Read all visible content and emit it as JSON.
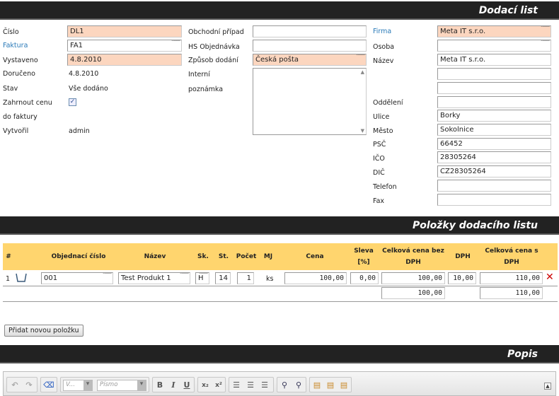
{
  "sections": {
    "delivery_note": "Dodací list",
    "items": "Položky dodacího listu",
    "description": "Popis"
  },
  "left": {
    "number_label": "Číslo",
    "number_value": "DL1",
    "invoice_label": "Faktura",
    "invoice_value": "FA1",
    "issued_label": "Vystaveno",
    "issued_value": "4.8.2010",
    "delivered_label": "Doručeno",
    "delivered_value": "4.8.2010",
    "state_label": "Stav",
    "state_value": "Vše dodáno",
    "include_price_label_1": "Zahrnout cenu",
    "include_price_label_2": "do faktury",
    "include_price_checked": true,
    "created_label": "Vytvořil",
    "created_value": "admin"
  },
  "middle": {
    "business_case_label": "Obchodní případ",
    "business_case_value": "",
    "hs_order_label": "HS Objednávka",
    "hs_order_value": "",
    "delivery_method_label": "Způsob dodání",
    "delivery_method_value": "Česká pošta",
    "internal_label": "Interní",
    "note_label": "poznámka",
    "note_value": ""
  },
  "right": {
    "company_label": "Firma",
    "company_value": "Meta IT s.r.o.",
    "person_label": "Osoba",
    "person_value": "",
    "name_label": "Název",
    "name_value": "Meta IT s.r.o.",
    "name_line2": "",
    "name_line3": "",
    "department_label": "Oddělení",
    "department_value": "",
    "street_label": "Ulice",
    "street_value": "Borky",
    "city_label": "Město",
    "city_value": "Sokolnice",
    "zip_label": "PSČ",
    "zip_value": "66452",
    "ico_label": "IČO",
    "ico_value": "28305264",
    "dic_label": "DIČ",
    "dic_value": "CZ28305264",
    "phone_label": "Telefon",
    "phone_value": "",
    "fax_label": "Fax",
    "fax_value": ""
  },
  "table": {
    "headers": {
      "index": "#",
      "order_no": "Objednací číslo",
      "name": "Název",
      "warehouse": "Sk.",
      "state": "St.",
      "count": "Počet",
      "unit": "MJ",
      "price": "Cena",
      "discount_1": "Sleva",
      "discount_2": "[%]",
      "total_novat_1": "Celková cena bez",
      "total_novat_2": "DPH",
      "vat": "DPH",
      "total_vat_1": "Celková cena s",
      "total_vat_2": "DPH"
    },
    "rows": [
      {
        "index": "1",
        "order_no": "001",
        "name": "Test Produkt 1",
        "warehouse": "H",
        "state": "14",
        "count": "1",
        "unit": "ks",
        "price": "100,00",
        "discount": "0,00",
        "total_novat": "100,00",
        "vat": "10,00",
        "total_vat": "110,00"
      }
    ],
    "sum_novat": "100,00",
    "sum_vat": "110,00",
    "add_button": "Přidat novou položku"
  },
  "toolbar": {
    "font_size_placeholder": "V...",
    "font_family_placeholder": "Písmo"
  },
  "colors": {
    "header_bar": "#222222",
    "required_field": "#fcd6bf",
    "table_header": "#ffd56e",
    "link": "#2a7ab8",
    "delete": "#cc0000"
  }
}
